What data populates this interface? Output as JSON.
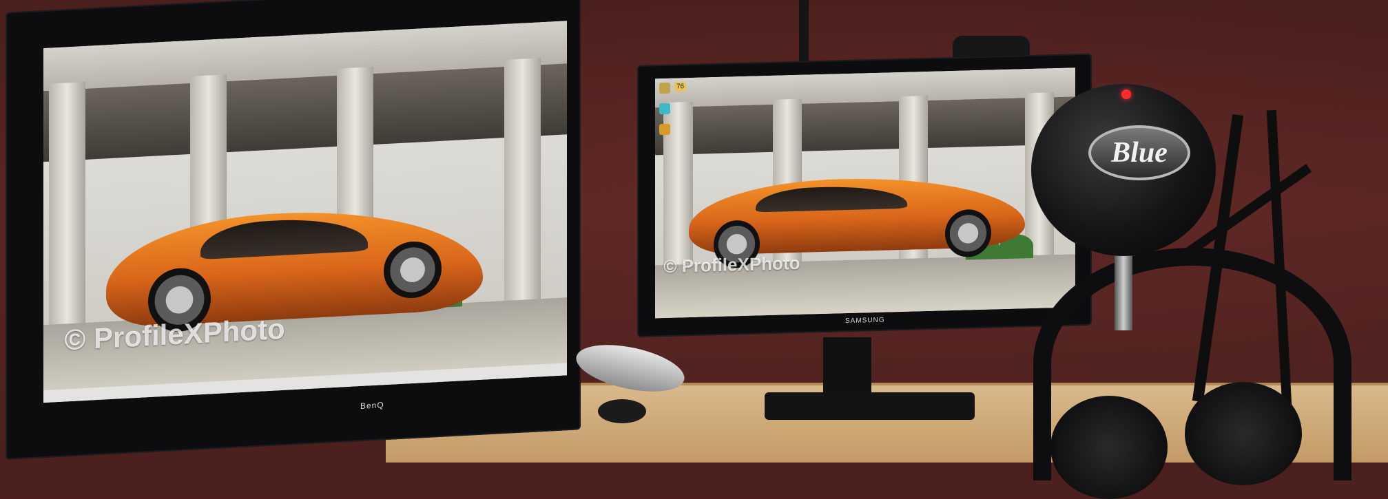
{
  "scene": {
    "left_monitor": {
      "brand": "BenQ",
      "watermark": "© ProfileXPhoto",
      "taskbar_visible": true
    },
    "right_monitor": {
      "brand": "SAMSUNG",
      "watermark": "© ProfileXPhoto",
      "desktop_badge": "76"
    },
    "microphone": {
      "logo": "Blue"
    }
  },
  "colors": {
    "wall": "#4f2220",
    "desk": "#d2ae7c",
    "car_orange": "#e8761f",
    "mic_led": "#ff2a2a"
  }
}
